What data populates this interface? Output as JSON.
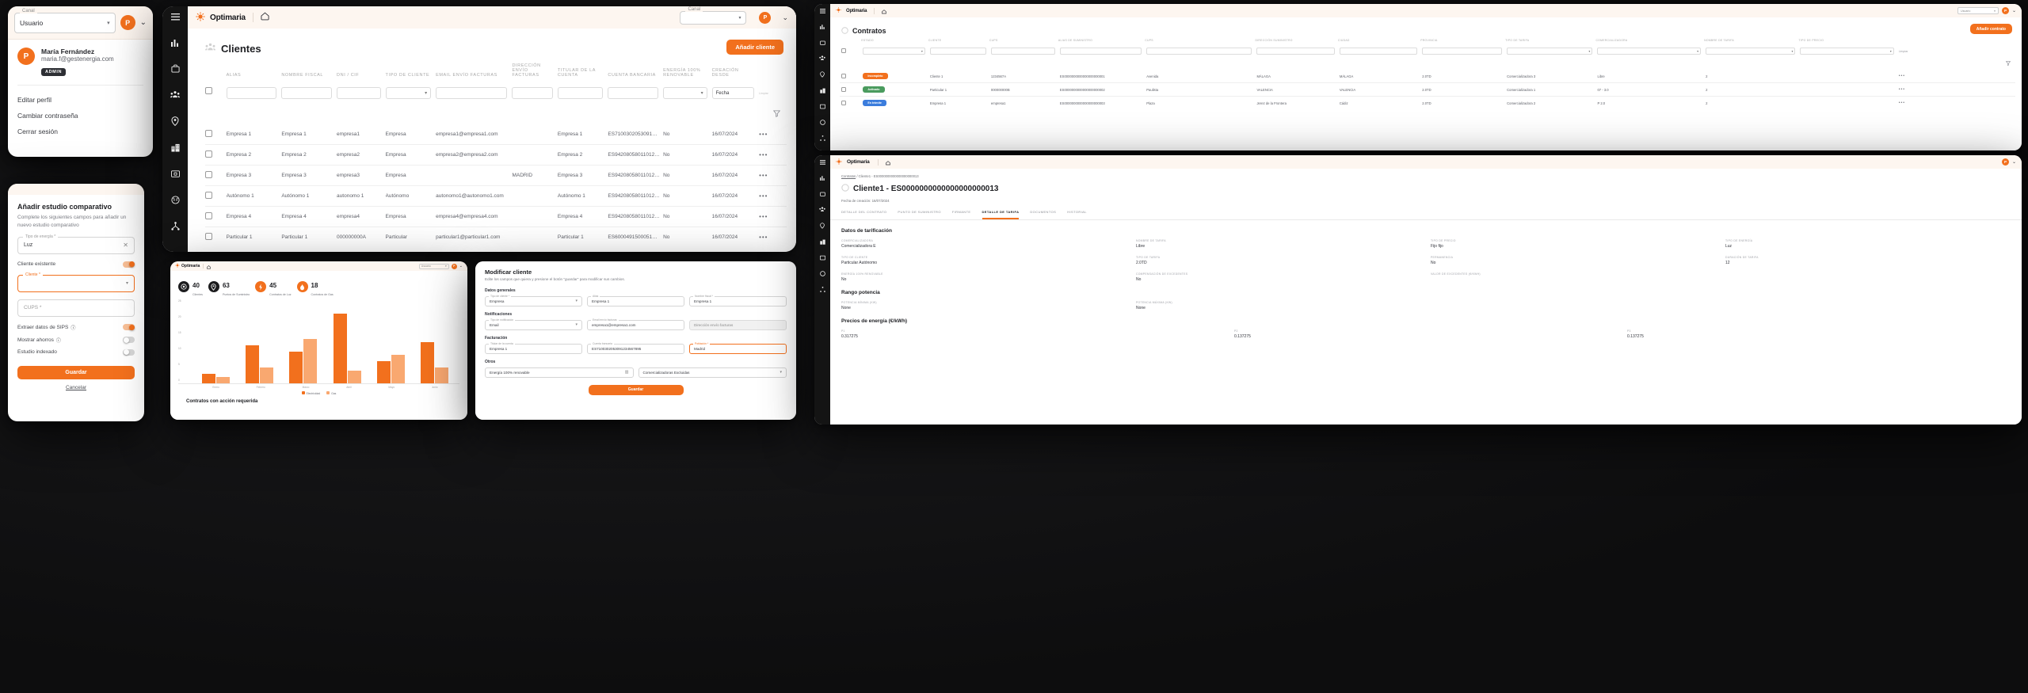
{
  "brand": {
    "name": "Optimaria",
    "accent": "#f2701d",
    "dark": "#141414",
    "cream": "#fdf6f0"
  },
  "profile_panel": {
    "canal_label": "Canal",
    "canal_value": "Usuario",
    "avatar_initial": "P",
    "user_name": "María Fernández",
    "user_email": "maria.f@gestenergia.com",
    "role_badge": "ADMIN",
    "links": [
      "Editar perfil",
      "Cambiar contraseña",
      "Cerrar sesión"
    ]
  },
  "study_panel": {
    "title": "Añadir estudio comparativo",
    "subtitle": "Complete los siguientes campos para añadir un nuevo estudio comparativo",
    "energy_label": "Tipo de energía *",
    "energy_value": "Luz",
    "existing_client_label": "Cliente existente",
    "existing_client_on": true,
    "client_label": "Cliente *",
    "client_value": "",
    "cups_label": "CUPS *",
    "cups_value": "",
    "toggles": [
      {
        "label": "Extraer datos de SIPS",
        "info": "i",
        "on": true
      },
      {
        "label": "Mostrar ahorros",
        "info": "i",
        "on": false
      },
      {
        "label": "Estudio indexado",
        "info": "",
        "on": false
      }
    ],
    "save_label": "Guardar",
    "cancel_label": "Cancelar"
  },
  "clients_window": {
    "brand": "Optimaria",
    "home_icon": "home-icon",
    "canal_label": "Canal",
    "canal_value": "",
    "avatar_initial": "P",
    "page_title": "Clientes",
    "add_button": "Añadir cliente",
    "clear_filters": "Limpiar",
    "columns": [
      "ALIAS",
      "NOMBRE FISCAL",
      "DNI / CIF",
      "TIPO DE CLIENTE",
      "EMAIL ENVÍO FACTURAS",
      "DIRECCIÓN ENVÍO FACTURAS",
      "TITULAR DE LA CUENTA",
      "CUENTA BANCARIA",
      "ENERGÍA 100% RENOVABLE",
      "CREACIÓN DESDE"
    ],
    "filter_date_placeholder": "Fecha",
    "rows": [
      {
        "alias": "Empresa 1",
        "fiscal": "Empresa 1",
        "dni": "empresa1",
        "tipo": "Empresa",
        "email": "empresa1@empresa1.com",
        "dir": "",
        "titular": "Empresa 1",
        "cuenta": "ES7100302053091234567…",
        "renov": "No",
        "fecha": "16/07/2024"
      },
      {
        "alias": "Empresa 2",
        "fiscal": "Empresa 2",
        "dni": "empresa2",
        "tipo": "Empresa",
        "email": "empresa2@empresa2.com",
        "dir": "",
        "titular": "Empresa 2",
        "cuenta": "ES9420805801101234567…",
        "renov": "No",
        "fecha": "16/07/2024"
      },
      {
        "alias": "Empresa 3",
        "fiscal": "Empresa 3",
        "dni": "empresa3",
        "tipo": "Empresa",
        "email": "",
        "dir": "MADRID",
        "titular": "Empresa 3",
        "cuenta": "ES9420805801101234567…",
        "renov": "No",
        "fecha": "16/07/2024"
      },
      {
        "alias": "Autónomo 1",
        "fiscal": "Autónomo 1",
        "dni": "autonomo 1",
        "tipo": "Autónomo",
        "email": "autonomo1@autonomo1.com",
        "dir": "",
        "titular": "Autónomo 1",
        "cuenta": "ES9420805801101234567…",
        "renov": "No",
        "fecha": "16/07/2024"
      },
      {
        "alias": "Empresa 4",
        "fiscal": "Empresa 4",
        "dni": "empresa4",
        "tipo": "Empresa",
        "email": "empresa4@empresa4.com",
        "dir": "",
        "titular": "Empresa 4",
        "cuenta": "ES9420805801101234567…",
        "renov": "No",
        "fecha": "16/07/2024"
      },
      {
        "alias": "Particular 1",
        "fiscal": "Particular 1",
        "dni": "000000000A",
        "tipo": "Particular",
        "email": "particular1@particular1.com",
        "dir": "",
        "titular": "Particular 1",
        "cuenta": "ES6000491500051234567…",
        "renov": "No",
        "fecha": "16/07/2024"
      }
    ]
  },
  "dashboard_window": {
    "brand": "Optimaria",
    "canal_value": "Usuario",
    "avatar_initial": "P",
    "kpis": [
      {
        "value": "40",
        "label": "Clientes",
        "icon": "target-icon",
        "style": "dark"
      },
      {
        "value": "63",
        "label": "Puntos de Suministro",
        "icon": "pin-icon",
        "style": "dark"
      },
      {
        "value": "45",
        "label": "Contratos de Luz",
        "icon": "bolt-icon",
        "style": "orange"
      },
      {
        "value": "18",
        "label": "Contratos de Gas",
        "icon": "flame-icon",
        "style": "orange"
      }
    ],
    "footer_title": "Contratos con acción requerida",
    "chart_data": {
      "type": "bar",
      "title": "",
      "categories": [
        "Enero",
        "Febrero",
        "Marzo",
        "Abril",
        "Mayo",
        "Junio"
      ],
      "series": [
        {
          "name": "Electricidad",
          "color": "#f2701d",
          "values": [
            3,
            12,
            10,
            22,
            7,
            13
          ]
        },
        {
          "name": "Gas",
          "color": "#f9a870",
          "values": [
            2,
            5,
            14,
            4,
            9,
            5
          ]
        }
      ],
      "ylim": [
        0,
        25
      ],
      "yticks": [
        0,
        5,
        10,
        15,
        20,
        25
      ],
      "xlabel": "",
      "ylabel": "",
      "grid": false,
      "legend_position": "bottom"
    }
  },
  "modify_window": {
    "brand": "Optimaria",
    "title": "Modificar cliente",
    "subtitle": "Edite los campos que quiera y presione el botón \"guardar\" para modificar sus cambios.",
    "sections": {
      "general": "Datos generales",
      "notifications": "Notificaciones",
      "billing": "Facturación",
      "others": "Otros"
    },
    "fields": {
      "tipo_cliente_label": "Tipo de cliente *",
      "tipo_cliente_value": "Empresa",
      "alias_label": "Alias",
      "alias_value": "Empresa 1",
      "nombre_label": "Nombre fiscal *",
      "nombre_value": "Empresa 1",
      "tipo_notif_label": "Tipo de notificación",
      "tipo_notif_value": "Email",
      "email_envio_label": "Email envío facturas",
      "email_envio_value": "empresa1@empresa1.com",
      "dir_envio_label": "Dirección envío facturas",
      "dir_envio_value": "Dirección envío facturas",
      "titular_label": "Titular de la cuenta",
      "titular_value": "Empresa 1",
      "cuenta_label": "Cuenta bancaria",
      "cuenta_value": "ES7100302053091234567895",
      "poblacion_label": "Población *",
      "poblacion_value": "Madrid",
      "renovable_label": "Energía 100% renovable",
      "comercializadora_label": "Comercializadoras Excluidas",
      "comercializadora_value": ""
    },
    "save_label": "Guardar"
  },
  "contracts_window": {
    "brand": "Optimaria",
    "canal_value": "Usuario",
    "avatar_initial": "P",
    "page_title": "Contratos",
    "add_button": "Añadir contrato",
    "clear_label": "Limpiar",
    "columns": [
      "ESTADO",
      "CLIENTE",
      "CUPS",
      "ALIAS DE SUMINISTRO",
      "CUPS",
      "DIRECCIÓN SUMINISTRO",
      "CIUDAD",
      "PROVINCIA",
      "TIPO DE TARIFA",
      "COMERCIALIZADORA",
      "NOMBRE DE TARIFA",
      "TIPO DE PRECIO"
    ],
    "rows": [
      {
        "estado": "Incompleto",
        "estado_color": "#f2701d",
        "cliente": "Cliente 1",
        "cups1": "1234567A",
        "alias": "ES0000000000000000000001",
        "cups2": "Avenida",
        "dir": "MÁLAGA",
        "ciudad": "MÁLAGA",
        "prov": "2.0TD",
        "tarifa": "Comercializadora 3",
        "com": "Libre",
        "precio": "2"
      },
      {
        "estado": "Activado",
        "estado_color": "#4a9b5e",
        "cliente": "Particular 1",
        "cups1": "000000000B",
        "alias": "ES0000000000000000000002",
        "cups2": "Paulista",
        "dir": "VALENCIA",
        "ciudad": "VALENCIA",
        "prov": "2.0TD",
        "tarifa": "Comercializadora 1",
        "com": "07 - 3.0",
        "precio": "2"
      },
      {
        "estado": "En trámite",
        "estado_color": "#3b7ddd",
        "cliente": "Empresa 1",
        "cups1": "empresa1",
        "alias": "ES0000000000000000000003",
        "cups2": "Plaza",
        "dir": "Jerez de la Frontera",
        "ciudad": "Cádiz",
        "prov": "2.0TD",
        "tarifa": "Comercializadora 2",
        "com": "P 2.0",
        "precio": "2"
      }
    ]
  },
  "detail_window": {
    "brand": "Optimaria",
    "breadcrumb": [
      "Contratos",
      "Cliente1 - ES0000000000000000000013"
    ],
    "title": "Cliente1 - ES0000000000000000000013",
    "created_label": "Fecha de creación",
    "created_value": "16/07/2024",
    "tabs": [
      {
        "label": "DETALLE DEL CONTRATO",
        "active": false
      },
      {
        "label": "PUNTO DE SUMINISTRO",
        "active": false
      },
      {
        "label": "FIRMANTE",
        "active": false
      },
      {
        "label": "DETALLE DE TARIFA",
        "active": true
      },
      {
        "label": "DOCUMENTOS",
        "active": false
      },
      {
        "label": "HISTORIAL",
        "active": false
      }
    ],
    "tarif_section": "Datos de tarificación",
    "tarif_fields": [
      {
        "key": "COMERCIALIZADORA",
        "value": "Comercializadora E"
      },
      {
        "key": "NOMBRE DE TARIFA",
        "value": "Libre"
      },
      {
        "key": "TIPO DE PRECIO",
        "value": "Fijo fijo"
      },
      {
        "key": "TIPO DE ENERGÍA",
        "value": "Luz"
      },
      {
        "key": "TIPO DE CLIENTE",
        "value": "Particular Autónomo"
      },
      {
        "key": "TIPO DE TARIFA",
        "value": "2.0TD"
      },
      {
        "key": "PERMANENCIA",
        "value": "No"
      },
      {
        "key": "DURACIÓN DE TARIFA",
        "value": "12"
      },
      {
        "key": "ENERGÍA 100% RENOVABLE",
        "value": "No"
      },
      {
        "key": "COMPENSACIÓN DE EXCEDENTES",
        "value": "No"
      },
      {
        "key": "VALOR DE EXCEDENTES (€/KWH)",
        "value": ""
      },
      {
        "key": "",
        "value": ""
      }
    ],
    "power_section": "Rango potencia",
    "power_fields": [
      {
        "key": "POTENCIA MÍNIMA (KW)",
        "value": "None"
      },
      {
        "key": "POTENCIA MÁXIMA (KW)",
        "value": "None"
      }
    ],
    "energy_section": "Precios de energía (€/kWh)",
    "energy_fields": [
      {
        "key": "P1",
        "value": "0.317275"
      },
      {
        "key": "P2",
        "value": "0.137275"
      },
      {
        "key": "P3",
        "value": "0.137275"
      }
    ]
  }
}
